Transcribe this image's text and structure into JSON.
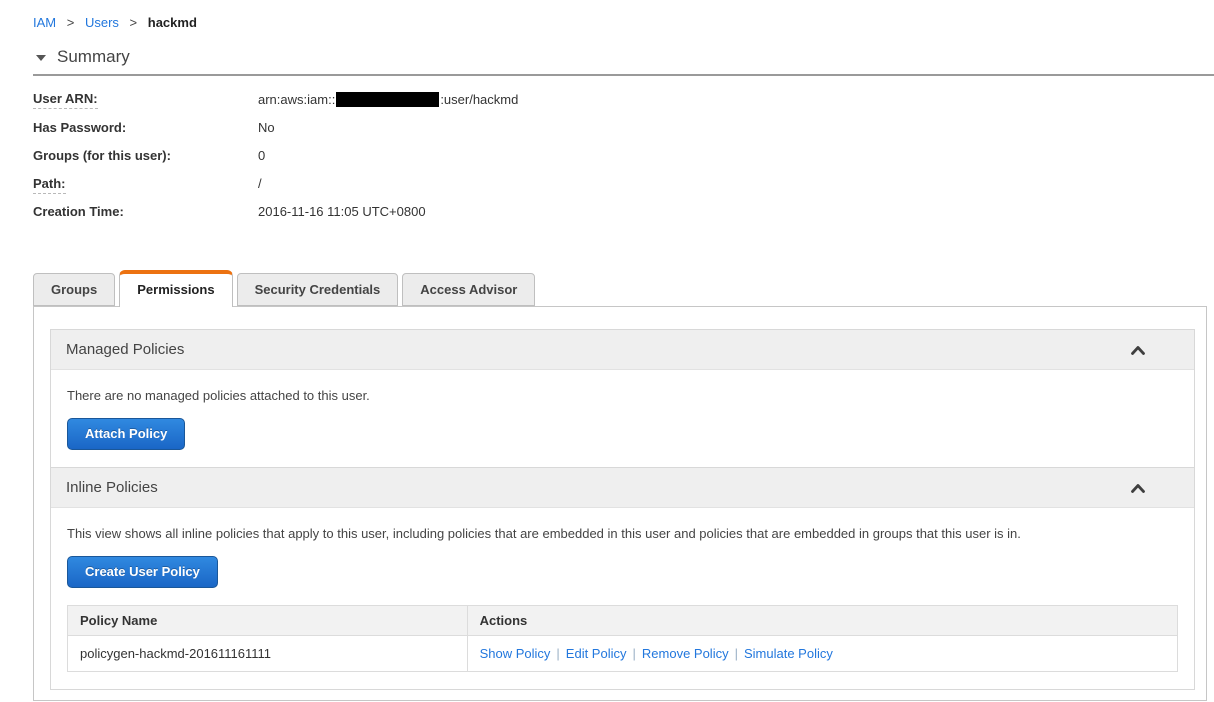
{
  "breadcrumb": {
    "separator": ">",
    "items": [
      {
        "label": "IAM"
      },
      {
        "label": "Users"
      },
      {
        "label": "hackmd"
      }
    ]
  },
  "summary": {
    "title": "Summary",
    "fields": [
      {
        "label": "User ARN:",
        "prefix": "arn:aws:iam::",
        "suffix": ":user/hackmd",
        "redacted": true
      },
      {
        "label": "Has Password:",
        "value": "No"
      },
      {
        "label": "Groups (for this user):",
        "value": "0"
      },
      {
        "label": "Path:",
        "value": "/"
      },
      {
        "label": "Creation Time:",
        "value": "2016-11-16 11:05 UTC+0800"
      }
    ]
  },
  "tabs": [
    {
      "label": "Groups",
      "active": false
    },
    {
      "label": "Permissions",
      "active": true
    },
    {
      "label": "Security Credentials",
      "active": false
    },
    {
      "label": "Access Advisor",
      "active": false
    }
  ],
  "sections": {
    "managed": {
      "title": "Managed Policies",
      "empty_text": "There are no managed policies attached to this user.",
      "attach_button_label": "Attach Policy"
    },
    "inline": {
      "title": "Inline Policies",
      "description": "This view shows all inline policies that apply to this user, including policies that are embedded in this user and policies that are embedded in groups that this user is in.",
      "create_button_label": "Create User Policy",
      "table": {
        "headers": [
          "Policy Name",
          "Actions"
        ],
        "action_separator": "|",
        "rows": [
          {
            "policy_name": "policygen-hackmd-201611161111",
            "actions": [
              "Show Policy",
              "Edit Policy",
              "Remove Policy",
              "Simulate Policy"
            ]
          }
        ]
      }
    }
  },
  "icons": {
    "summary_collapse": "triangle-down",
    "section_collapse": "chevron-up"
  },
  "colors": {
    "link_blue": "#2277dd",
    "tab_accent_orange": "#ec7211",
    "button_blue_top": "#3089e0",
    "button_blue_bottom": "#1a66c6",
    "redaction_black": "#000000"
  }
}
